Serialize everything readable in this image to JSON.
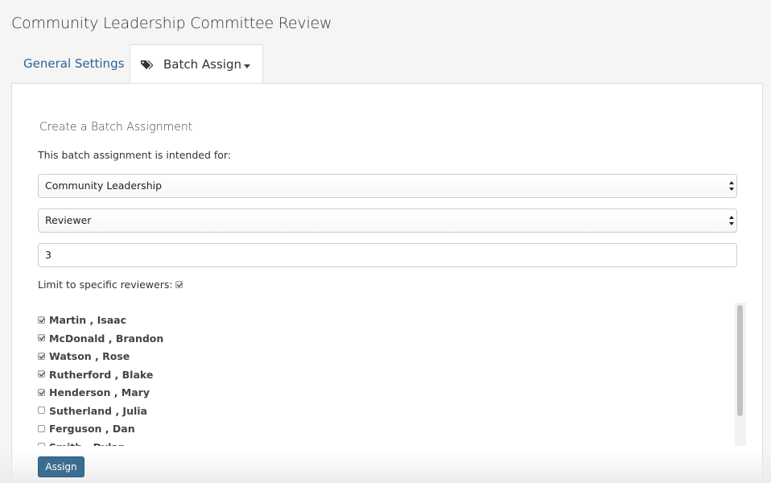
{
  "page": {
    "title": "Community Leadership Committee Review"
  },
  "tabs": [
    {
      "label": "General Settings"
    },
    {
      "label": "Batch Assign"
    }
  ],
  "form": {
    "heading": "Create a Batch Assignment",
    "intro": "This batch assignment is intended for:",
    "program_select": {
      "value": "Community Leadership"
    },
    "role_select": {
      "value": "Reviewer"
    },
    "count_input": {
      "value": "3"
    },
    "limit_label": "Limit to specific reviewers:",
    "limit_checked": true
  },
  "reviewers": [
    {
      "name": "Martin , Isaac",
      "checked": true
    },
    {
      "name": "McDonald , Brandon",
      "checked": true
    },
    {
      "name": "Watson , Rose",
      "checked": true
    },
    {
      "name": "Rutherford , Blake",
      "checked": true
    },
    {
      "name": "Henderson , Mary",
      "checked": true
    },
    {
      "name": "Sutherland , Julia",
      "checked": false
    },
    {
      "name": "Ferguson , Dan",
      "checked": false
    },
    {
      "name": "Smith , Dylan",
      "checked": false
    }
  ],
  "actions": {
    "assign_label": "Assign"
  }
}
